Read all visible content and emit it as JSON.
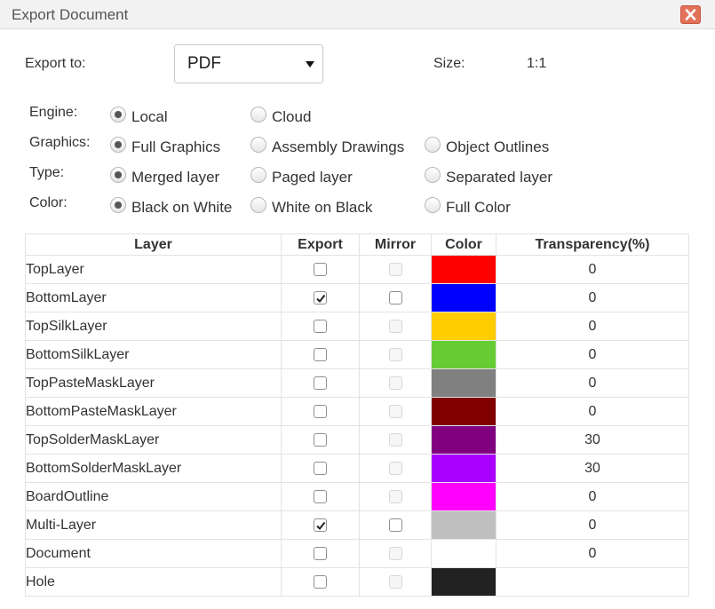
{
  "dialog": {
    "title": "Export Document",
    "close_icon": "close-x-icon"
  },
  "export": {
    "label": "Export to:",
    "value": "PDF"
  },
  "size": {
    "label": "Size:",
    "value": "1:1"
  },
  "options": [
    {
      "label": "Engine:",
      "choices": [
        "Local",
        "Cloud"
      ],
      "selected": 0
    },
    {
      "label": "Graphics:",
      "choices": [
        "Full Graphics",
        "Assembly Drawings",
        "Object Outlines"
      ],
      "selected": 0
    },
    {
      "label": "Type:",
      "choices": [
        "Merged layer",
        "Paged layer",
        "Separated layer"
      ],
      "selected": 0
    },
    {
      "label": "Color:",
      "choices": [
        "Black on White",
        "White on Black",
        "Full Color"
      ],
      "selected": 0
    }
  ],
  "table": {
    "headers": [
      "Layer",
      "Export",
      "Mirror",
      "Color",
      "Transparency(%)"
    ],
    "rows": [
      {
        "name": "TopLayer",
        "export": false,
        "mirror": false,
        "mirror_enabled": false,
        "color": "#ff0000",
        "transparency": "0"
      },
      {
        "name": "BottomLayer",
        "export": true,
        "mirror": false,
        "mirror_enabled": true,
        "color": "#0000ff",
        "transparency": "0"
      },
      {
        "name": "TopSilkLayer",
        "export": false,
        "mirror": false,
        "mirror_enabled": false,
        "color": "#ffcc00",
        "transparency": "0"
      },
      {
        "name": "BottomSilkLayer",
        "export": false,
        "mirror": false,
        "mirror_enabled": false,
        "color": "#66cc33",
        "transparency": "0"
      },
      {
        "name": "TopPasteMaskLayer",
        "export": false,
        "mirror": false,
        "mirror_enabled": false,
        "color": "#808080",
        "transparency": "0"
      },
      {
        "name": "BottomPasteMaskLayer",
        "export": false,
        "mirror": false,
        "mirror_enabled": false,
        "color": "#800000",
        "transparency": "0"
      },
      {
        "name": "TopSolderMaskLayer",
        "export": false,
        "mirror": false,
        "mirror_enabled": false,
        "color": "#800080",
        "transparency": "30"
      },
      {
        "name": "BottomSolderMaskLayer",
        "export": false,
        "mirror": false,
        "mirror_enabled": false,
        "color": "#aa00ff",
        "transparency": "30"
      },
      {
        "name": "BoardOutline",
        "export": false,
        "mirror": false,
        "mirror_enabled": false,
        "color": "#ff00ff",
        "transparency": "0"
      },
      {
        "name": "Multi-Layer",
        "export": true,
        "mirror": false,
        "mirror_enabled": true,
        "color": "#c0c0c0",
        "transparency": "0"
      },
      {
        "name": "Document",
        "export": false,
        "mirror": false,
        "mirror_enabled": false,
        "color": "#ffffff",
        "transparency": "0"
      },
      {
        "name": "Hole",
        "export": false,
        "mirror": false,
        "mirror_enabled": false,
        "color": "#222222",
        "transparency": ""
      }
    ]
  }
}
